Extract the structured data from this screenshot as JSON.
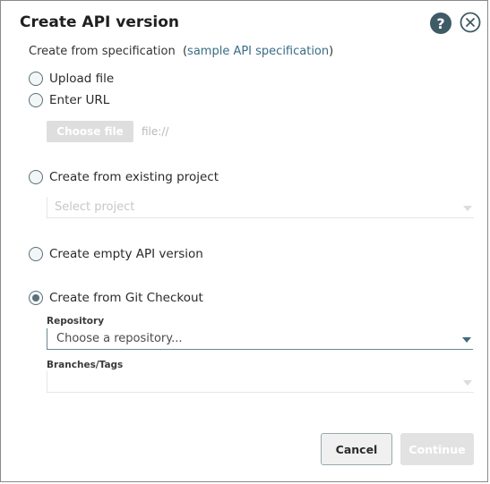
{
  "dialog": {
    "title": "Create API version",
    "subtitle_prefix": "Create from specification",
    "subtitle_paren_open": "(",
    "subtitle_link": "sample API specification",
    "subtitle_paren_close": ")",
    "options": {
      "upload_file": "Upload file",
      "enter_url": "Enter URL",
      "existing_project": "Create from existing project",
      "empty_api": "Create empty API version",
      "git_checkout": "Create from Git Checkout"
    },
    "selected_option": "git_checkout",
    "choose_file_label": "Choose file",
    "file_hint": "file://",
    "project_select_placeholder": "Select project",
    "repository_label": "Repository",
    "repository_placeholder": "Choose a repository...",
    "branches_label": "Branches/Tags",
    "branches_value": "",
    "cancel_label": "Cancel",
    "continue_label": "Continue"
  },
  "icons": {
    "help": "help-icon",
    "close": "close-icon"
  },
  "colors": {
    "accent": "#3f5b65",
    "link": "#3a6c84"
  }
}
